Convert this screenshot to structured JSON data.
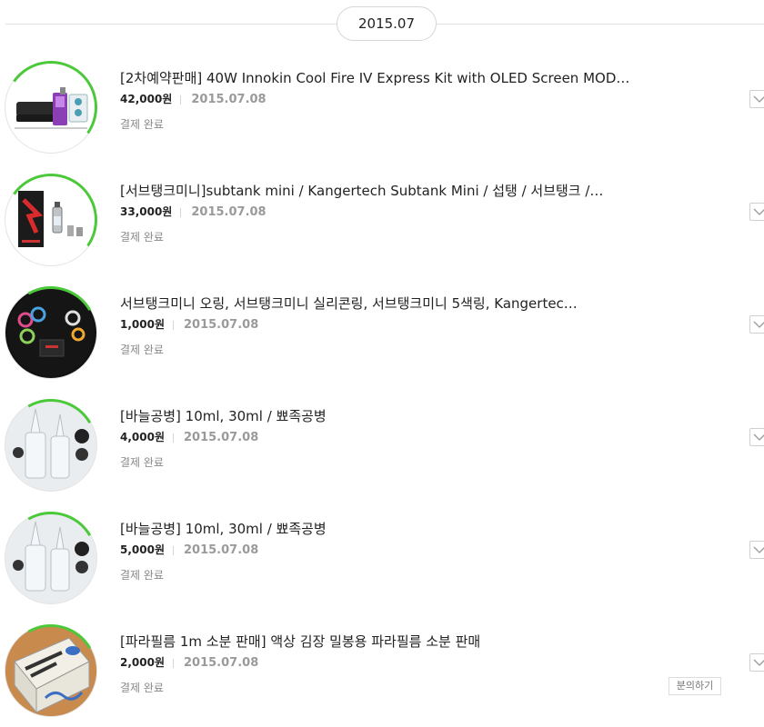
{
  "month_label": "2015.07",
  "orders": [
    {
      "title": "[2차예약판매] 40W Innokin Cool Fire IV Express Kit with OLED Screen MOD…",
      "price": "42,000원",
      "date": "2015.07.08",
      "status": "결제 완료",
      "image": "vape-kit-purple"
    },
    {
      "title": "[서브탱크미니]subtank mini / Kangertech Subtank Mini / 섭탱 / 서브탱크 /…",
      "price": "33,000원",
      "date": "2015.07.08",
      "status": "결제 완료",
      "image": "tank-box-red"
    },
    {
      "title": "서브탱크미니 오링, 서브탱크미니 실리콘링, 서브탱크미니 5색링, Kangertec…",
      "price": "1,000원",
      "date": "2015.07.08",
      "status": "결제 완료",
      "image": "silicone-rings"
    },
    {
      "title": "[바늘공병] 10ml, 30ml / 뾰족공병",
      "price": "4,000원",
      "date": "2015.07.08",
      "status": "결제 완료",
      "image": "needle-bottles"
    },
    {
      "title": "[바늘공병] 10ml, 30ml / 뾰족공병",
      "price": "5,000원",
      "date": "2015.07.08",
      "status": "결제 완료",
      "image": "needle-bottles"
    },
    {
      "title": "[파라필름 1m 소분 판매] 액상 김장 밀봉용 파라필름 소분 판매",
      "price": "2,000원",
      "date": "2015.07.08",
      "status": "결제 완료",
      "image": "parafilm-box"
    }
  ],
  "inquiry_label": "분의하기"
}
